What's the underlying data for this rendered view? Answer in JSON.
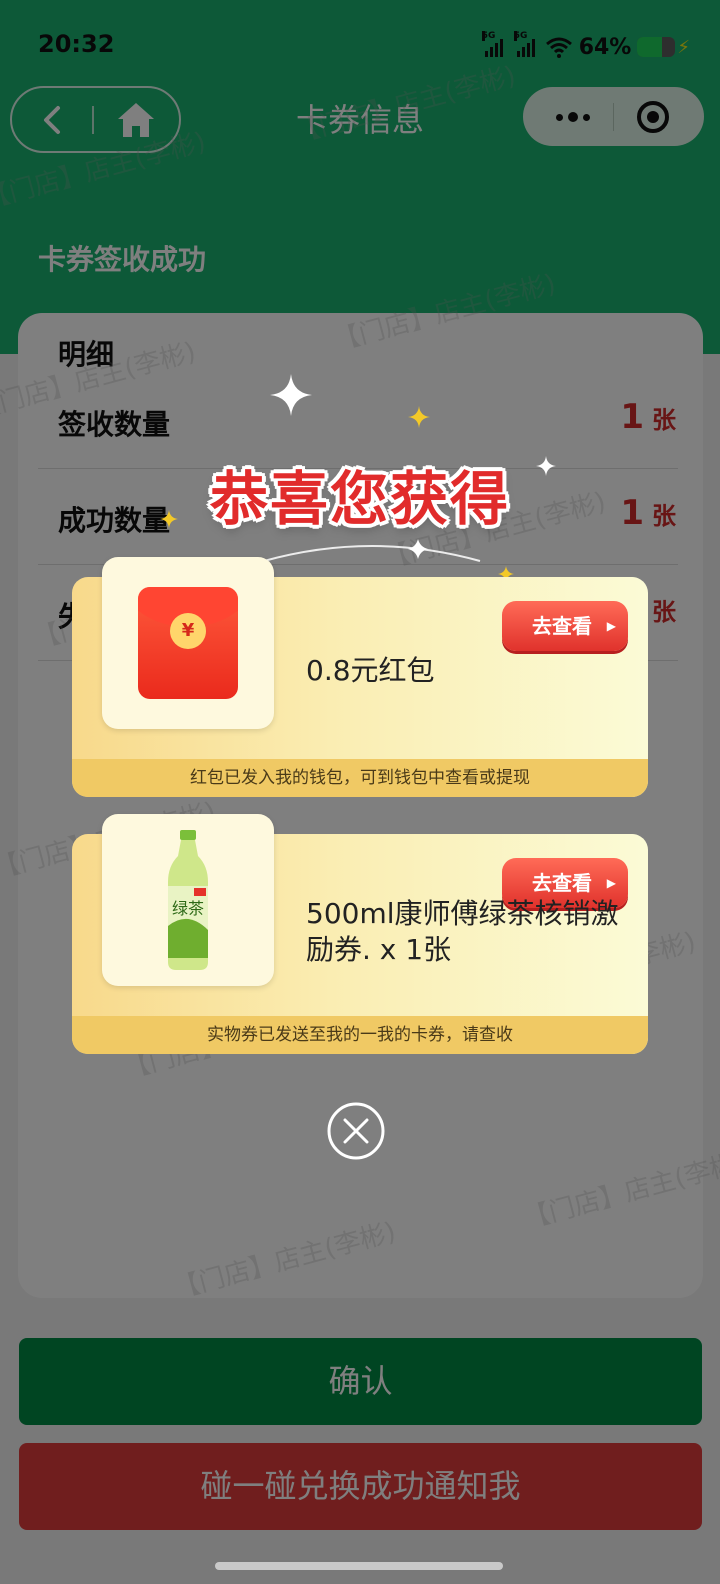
{
  "status_bar": {
    "time": "20:32",
    "signal1_label": "5G",
    "signal2_label": "5G",
    "battery_text": "64%",
    "battery_level": 0.64
  },
  "nav": {
    "title": "卡券信息",
    "back_icon": "chevron-left-icon",
    "home_icon": "home-icon",
    "more_icon": "more-dots-icon",
    "close_icon": "target-circle-icon"
  },
  "page": {
    "band_title": "卡券签收成功",
    "card_heading": "明细",
    "rows": [
      {
        "label": "签收数量",
        "value": "1",
        "unit": "张"
      },
      {
        "label": "成功数量",
        "value": "1",
        "unit": "张"
      },
      {
        "label": "失",
        "value": "",
        "unit": "张"
      }
    ],
    "confirm_label": "确认",
    "notify_label": "碰一碰兑换成功通知我",
    "watermark": "【门店】店主(李彬)"
  },
  "modal": {
    "title": "恭喜您获得",
    "rewards": [
      {
        "name": "0.8元红包",
        "button": "去查看",
        "note": "红包已发入我的钱包，可到钱包中查看或提现",
        "icon": "red-packet-icon",
        "coin_symbol": "¥"
      },
      {
        "name": "500ml康师傅绿茶核销激励券. x 1张",
        "button": "去查看",
        "note": "实物券已发送至我的一我的卡券，请查收",
        "icon": "green-tea-bottle-icon",
        "bottle_text": "绿茶"
      }
    ],
    "close_icon": "close-circle-icon"
  },
  "colors": {
    "brand_green": "#1ab370",
    "confirm_green": "#018b45",
    "notify_red": "#e03d3d",
    "accent_red": "#e12b2b"
  }
}
